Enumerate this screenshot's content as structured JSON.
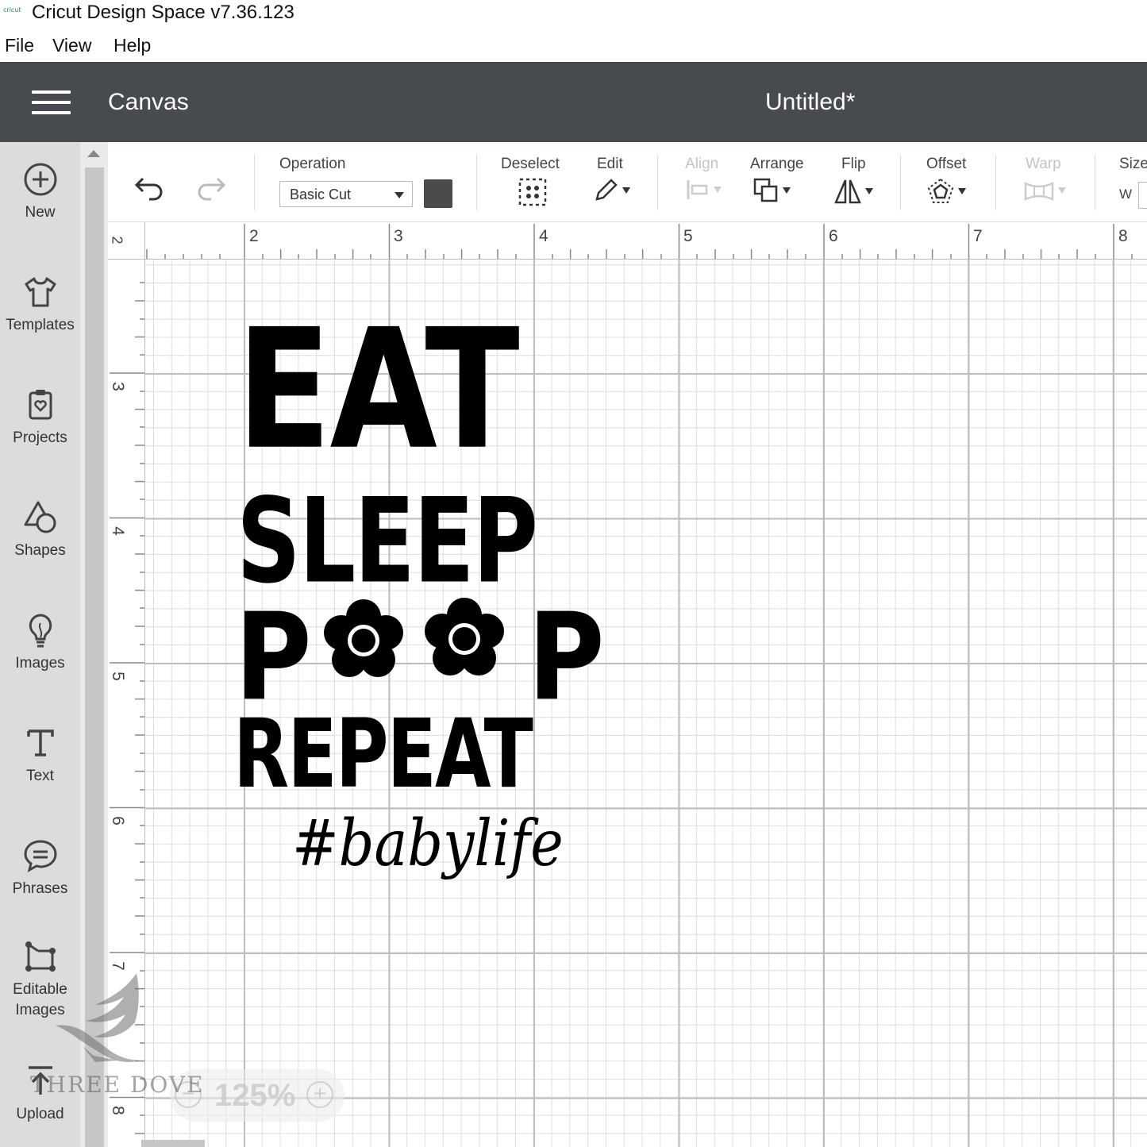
{
  "window": {
    "app_title": "Cricut Design Space  v7.36.123",
    "logo_text": "cricut"
  },
  "menubar": {
    "items": [
      "File",
      "View",
      "Help"
    ]
  },
  "header": {
    "section": "Canvas",
    "doc_title": "Untitled*",
    "menu_icon": "hamburger-icon"
  },
  "sidebar": {
    "items": [
      {
        "label": "New",
        "icon": "plus-circle-icon"
      },
      {
        "label": "Templates",
        "icon": "tshirt-icon"
      },
      {
        "label": "Projects",
        "icon": "clipboard-heart-icon"
      },
      {
        "label": "Shapes",
        "icon": "shapes-icon"
      },
      {
        "label": "Images",
        "icon": "lightbulb-icon"
      },
      {
        "label": "Text",
        "icon": "text-t-icon"
      },
      {
        "label": "Phrases",
        "icon": "speech-bubble-icon"
      },
      {
        "label": "Editable",
        "label2": "Images",
        "icon": "editable-image-icon"
      },
      {
        "label": "Upload",
        "icon": "upload-icon"
      }
    ]
  },
  "toolbar": {
    "operation_label": "Operation",
    "operation_value": "Basic Cut",
    "operation_color": "#4b4b4b",
    "deselect": "Deselect",
    "edit": "Edit",
    "align": "Align",
    "arrange": "Arrange",
    "flip": "Flip",
    "offset": "Offset",
    "warp": "Warp",
    "size": "Size",
    "size_w": "W"
  },
  "rulers": {
    "top": [
      "2",
      "2",
      "3",
      "4",
      "5",
      "6",
      "7",
      "8"
    ],
    "left": [
      "3",
      "4",
      "5",
      "6",
      "7",
      "8"
    ]
  },
  "design": {
    "words": [
      "EAT",
      "SLEEP",
      "P",
      "P",
      "REPEAT"
    ],
    "hashtag": "#babylife"
  },
  "zoom": {
    "value": "125%",
    "minus": "−",
    "plus": "+"
  },
  "watermark": {
    "text": "THREE DOVE"
  }
}
